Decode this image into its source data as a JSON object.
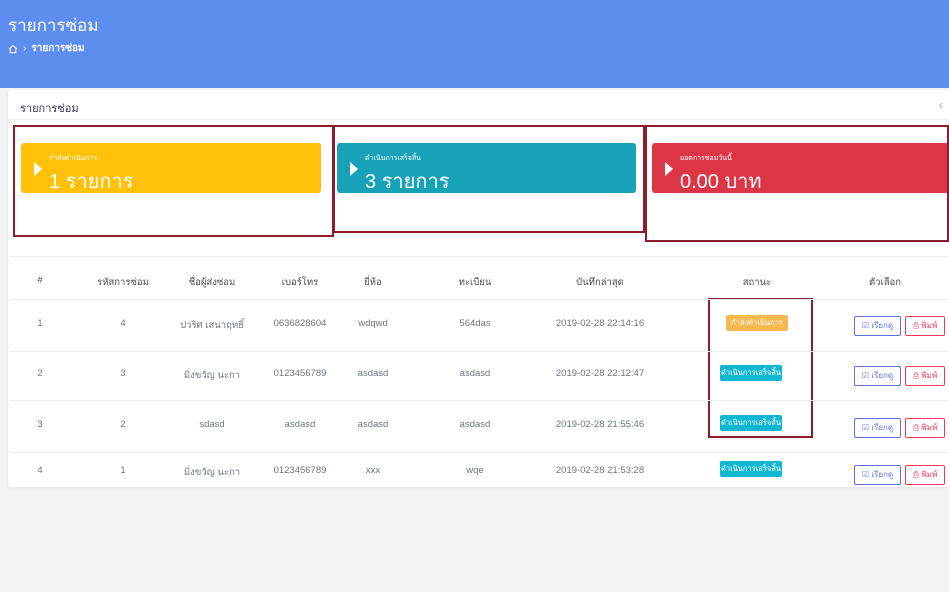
{
  "header": {
    "title": "รายการซ่อม",
    "breadcrumb": "รายการซ่อม"
  },
  "card": {
    "title": "รายการซ่อม",
    "collapse": "‹"
  },
  "stats": [
    {
      "label": "กำลังดำเนินการ",
      "value": "1 รายการ",
      "color": "#ffc107"
    },
    {
      "label": "ดำเนินการเสร็จสิ้น",
      "value": "3 รายการ",
      "color": "#17a2b8"
    },
    {
      "label": "ยอดการซ่อมวันนี้",
      "value": "0.00 บาท",
      "color": "#dc3545"
    }
  ],
  "table": {
    "headers": [
      "#",
      "รหัสการซ่อม",
      "ชื่อผู้ส่งซ่อม",
      "เบอร์โทร",
      "ยี่ห้อ",
      "ทะเบียน",
      "บันทึกล่าสุด",
      "สถานะ",
      "ตัวเลือก"
    ],
    "rows": [
      {
        "no": "1",
        "code": "4",
        "name": "ปวริศ เสนาฤทธิ์",
        "phone": "0636828604",
        "brand": "wdqwd",
        "plate": "564das",
        "updated": "2019-02-28 22:14:16",
        "status": "กำลังดำเนินการ",
        "status_type": "warn"
      },
      {
        "no": "2",
        "code": "3",
        "name": "มิ่งขวัญ นะกา",
        "phone": "0123456789",
        "brand": "asdasd",
        "plate": "asdasd",
        "updated": "2019-02-28 22:12:47",
        "status": "ดำเนินการเสร็จสิ้น",
        "status_type": "done"
      },
      {
        "no": "3",
        "code": "2",
        "name": "sdasd",
        "phone": "asdasd",
        "brand": "asdasd",
        "plate": "asdasd",
        "updated": "2019-02-28 21:55:46",
        "status": "ดำเนินการเสร็จสิ้น",
        "status_type": "done"
      },
      {
        "no": "4",
        "code": "1",
        "name": "มิ่งขวัญ นะกา",
        "phone": "0123456789",
        "brand": "xxx",
        "plate": "wqe",
        "updated": "2019-02-28 21:53:28",
        "status": "ดำเนินการเสร็จสิ้น",
        "status_type": "done"
      }
    ],
    "edit_label": "เรียกดู",
    "print_label": "พิมพ์"
  },
  "colors": {
    "header": "#5e8df0",
    "highlight": "#8b1e2a"
  }
}
